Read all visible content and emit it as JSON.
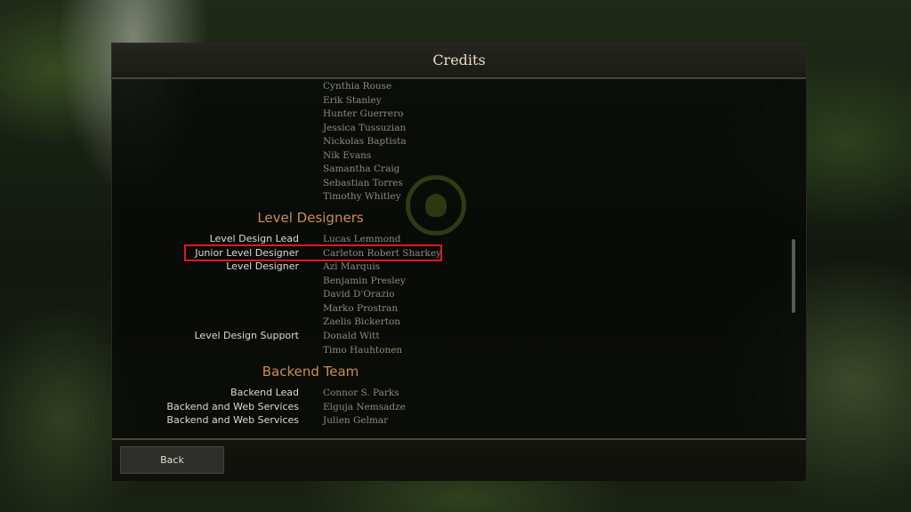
{
  "screen": {
    "title": "Credits"
  },
  "credits": {
    "top_names": [
      "Cynthia Rouse",
      "Erik Stanley",
      "Hunter Guerrero",
      "Jessica Tussuzian",
      "Nickolas Baptista",
      "Nik Evans",
      "Samantha Craig",
      "Sebastian Torres",
      "Timothy Whitley"
    ],
    "sections": [
      {
        "title": "Level Designers",
        "entries": [
          {
            "role": "Level Design Lead",
            "name": "Lucas Lemmond"
          },
          {
            "role": "Junior Level Designer",
            "name": "Carleton Robert Sharkey",
            "highlighted": true
          },
          {
            "role": "Level Designer",
            "name": "Azi Marquis"
          },
          {
            "role": "",
            "name": "Benjamin Presley"
          },
          {
            "role": "",
            "name": "David D'Orazio"
          },
          {
            "role": "",
            "name": "Marko Prostran"
          },
          {
            "role": "",
            "name": "Zaelis Bickerton"
          },
          {
            "role": "Level Design Support",
            "name": "Donald Witt"
          },
          {
            "role": "",
            "name": "Timo Hauhtonen"
          }
        ]
      },
      {
        "title": "Backend Team",
        "entries": [
          {
            "role": "Backend Lead",
            "name": "Connor S. Parks"
          },
          {
            "role": "Backend and Web Services",
            "name": "Elguja Nemsadze"
          },
          {
            "role": "Backend and Web Services",
            "name": "Julien Gelmar"
          }
        ]
      }
    ]
  },
  "footer": {
    "back_label": "Back"
  },
  "colors": {
    "highlight_border": "#e0191e",
    "section_title": "#c98d55"
  }
}
